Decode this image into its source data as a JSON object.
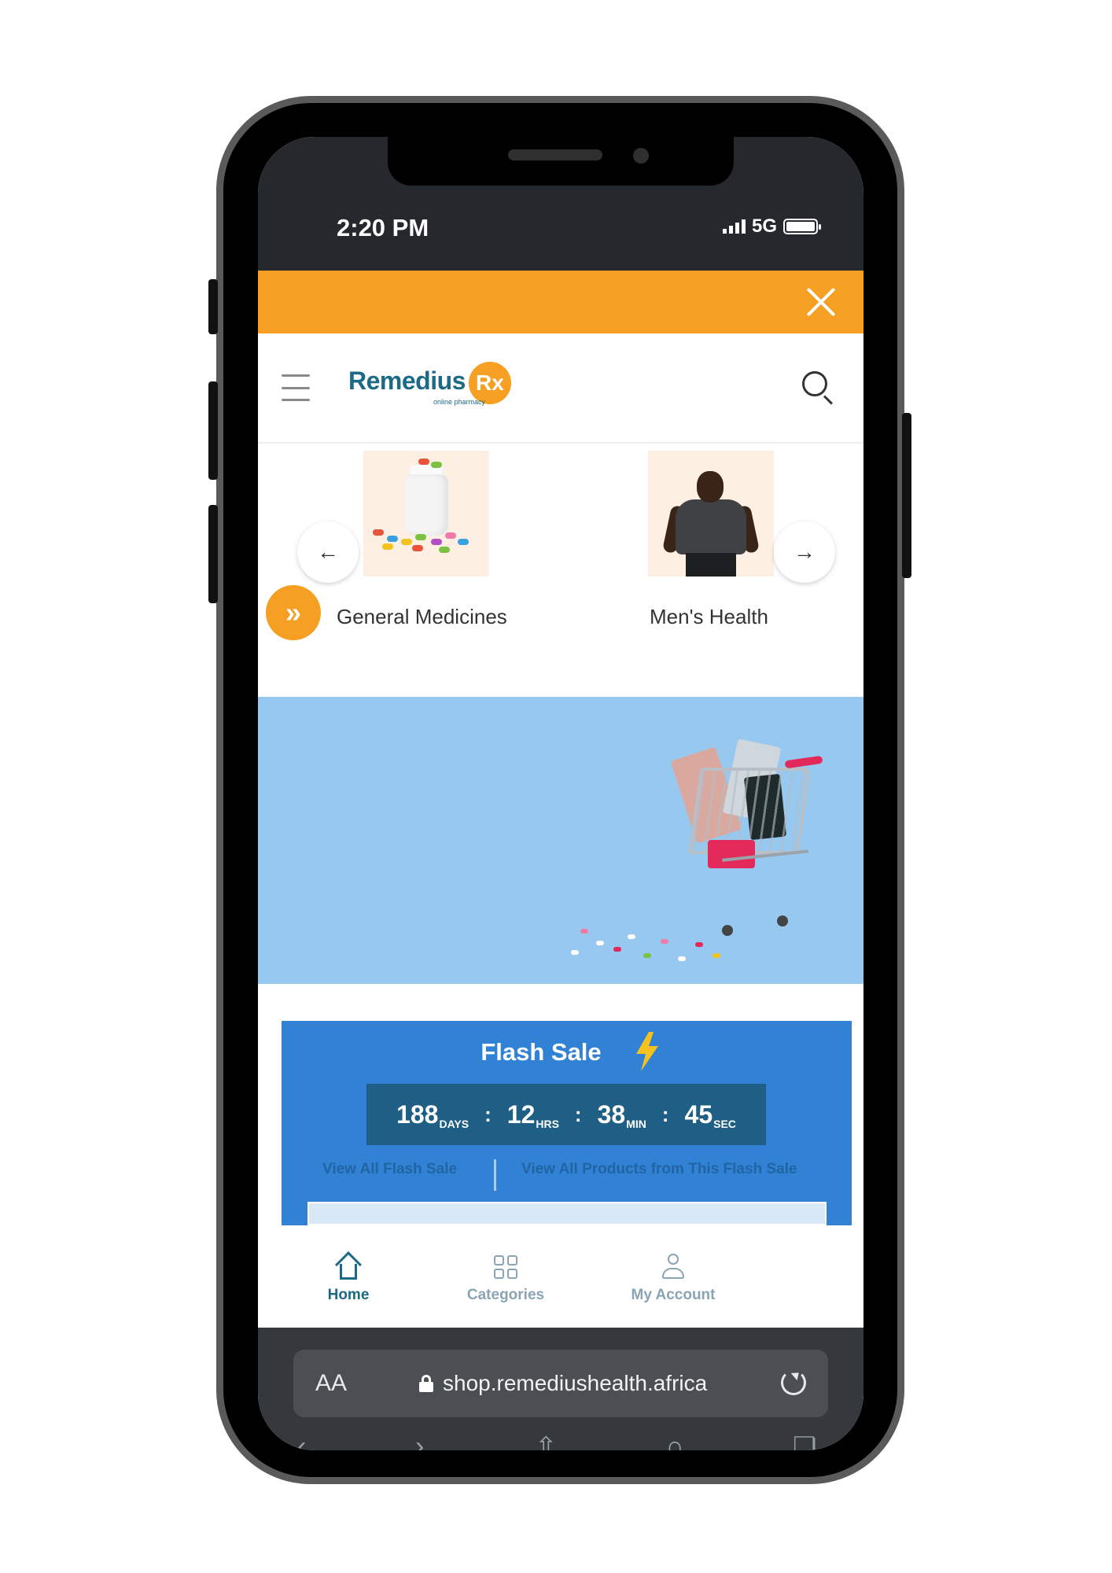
{
  "status_bar": {
    "time": "2:20 PM",
    "network": "5G"
  },
  "promo_bar": {
    "color": "#f6a023",
    "close_icon": "close-icon"
  },
  "header": {
    "logo_text": "Remedius",
    "logo_badge": "Rx",
    "logo_tagline": "online pharmacy",
    "menu_icon": "hamburger-icon",
    "search_icon": "search-icon"
  },
  "categories": {
    "prev_icon": "arrow-left-icon",
    "next_icon": "arrow-right-icon",
    "expand_icon": "double-chevron-right-icon",
    "items": [
      {
        "label": "General Medicines"
      },
      {
        "label": "Men's Health"
      }
    ]
  },
  "flash_sale": {
    "title": "Flash Sale",
    "countdown": {
      "days": "188",
      "days_unit": "DAYS",
      "hours": "12",
      "hours_unit": "HRS",
      "minutes": "38",
      "minutes_unit": "MIN",
      "seconds": "45",
      "seconds_unit": "SEC",
      "separator": ":"
    },
    "link_all": "View All Flash Sale",
    "link_products": "View All Products from This Flash Sale"
  },
  "bottom_nav": {
    "items": [
      {
        "label": "Home",
        "icon": "home-icon",
        "active": true
      },
      {
        "label": "Categories",
        "icon": "grid-icon",
        "active": false
      },
      {
        "label": "My Account",
        "icon": "user-icon",
        "active": false
      }
    ]
  },
  "browser": {
    "text_size_label": "AA",
    "url": "shop.remediushealth.africa"
  },
  "colors": {
    "brand_orange": "#f6a023",
    "brand_teal": "#1d6a86",
    "flash_blue": "#3181d5",
    "banner_blue": "#97c8f0"
  }
}
